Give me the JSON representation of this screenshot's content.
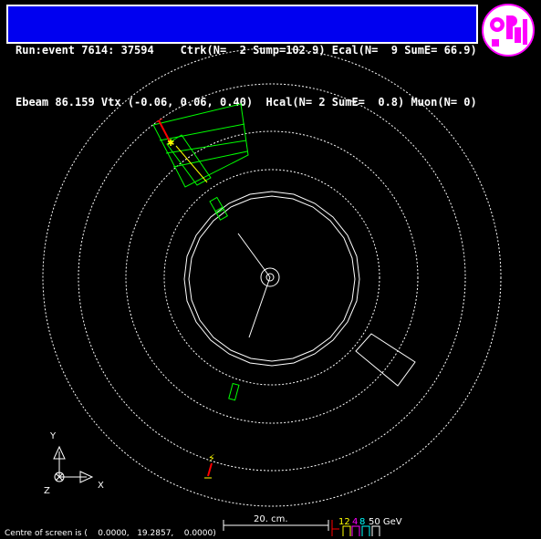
{
  "header": {
    "line1": "Run:event 7614: 37594    Ctrk(N=  2 Sump=102.9) Ecal(N=  9 SumE= 66.9)",
    "line2": "Ebeam 86.159 Vtx (-0.06, 0.06, 0.40)  Hcal(N= 2 SumE=  0.8) Muon(N= 0)"
  },
  "logo": {
    "text": "OPAL",
    "color": "#ff00ff"
  },
  "axes": {
    "y_label": "Y",
    "x_label": "X",
    "z_label": "Z"
  },
  "scale_bar": {
    "label": "20. cm."
  },
  "energy_scale": {
    "labels": [
      "12",
      "4",
      "8",
      "50 GeV"
    ],
    "colors": [
      "#ffff00",
      "#ff00ff",
      "#00ffff",
      "#ffffff"
    ]
  },
  "footer": {
    "centre_text": "Centre of screen is (    0.0000,   19.2857,    0.0000)"
  },
  "colors": {
    "background": "#000000",
    "header_bg": "#0000f0",
    "track": "#ffffff",
    "ecal": "#00ff00",
    "muon": "#ff0000",
    "yellow": "#ffff00"
  }
}
